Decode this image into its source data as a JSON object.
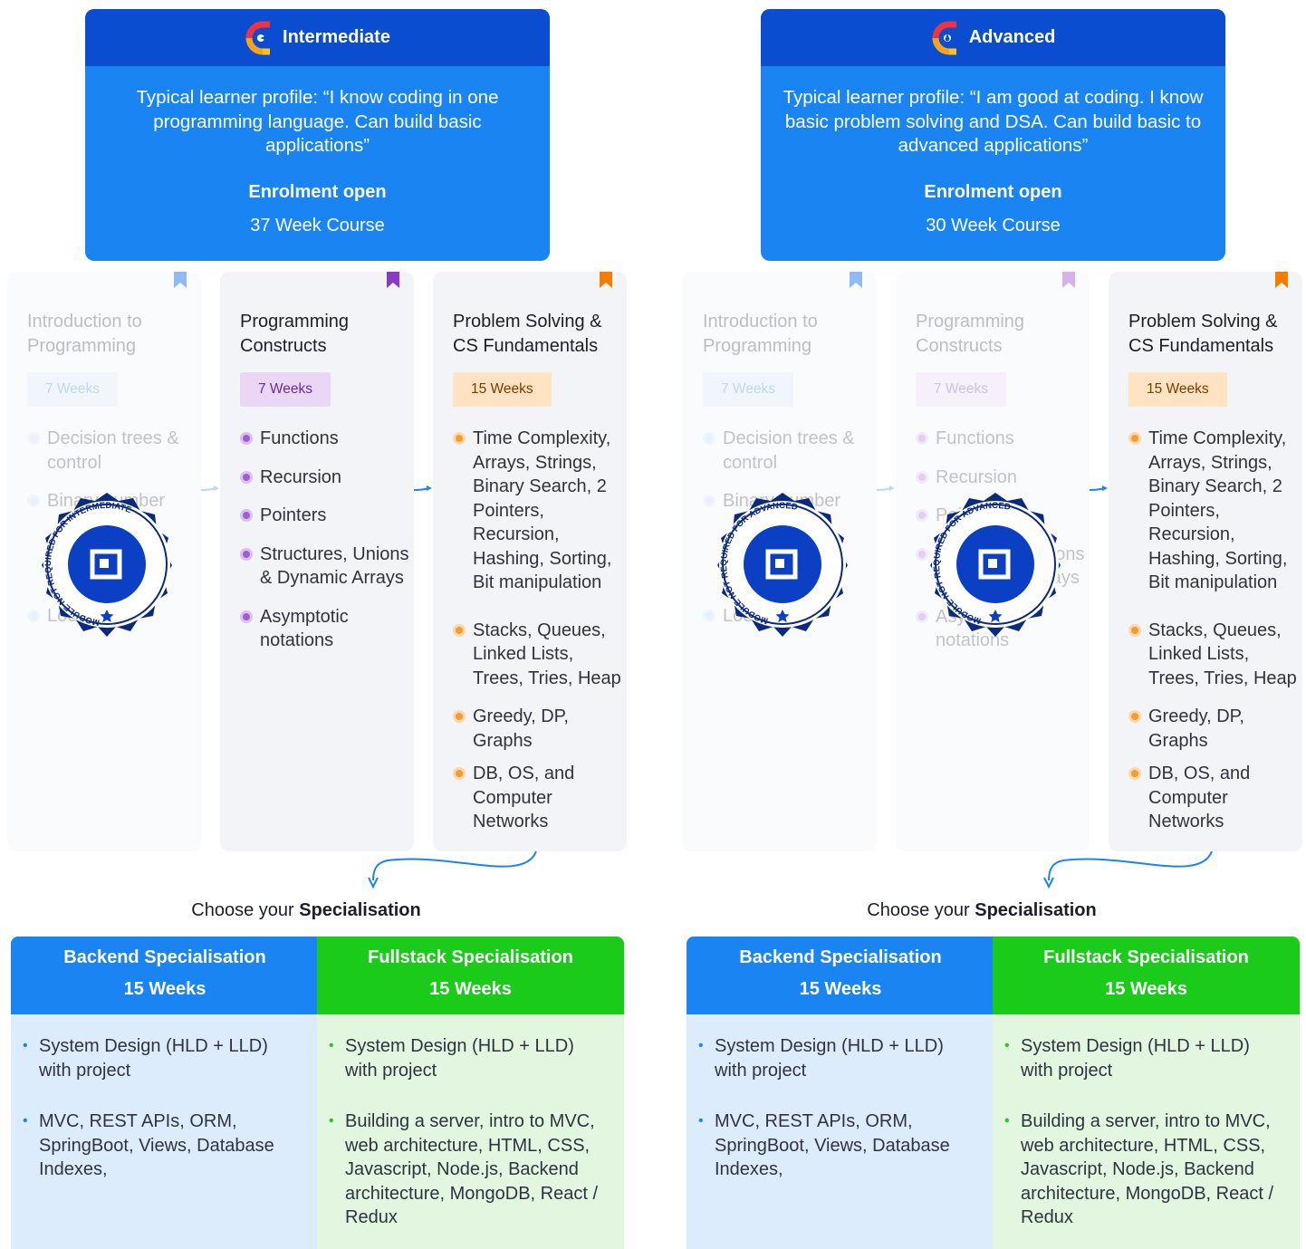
{
  "tracks": [
    {
      "title": "Intermediate",
      "profile": "Typical learner profile: “I know coding in one programming language. Can build basic applications”",
      "enrolment": "Enrolment open",
      "duration": "37 Week Course",
      "badge_text": "MODULE NOT REQUIRED FOR INTERMEDIATE"
    },
    {
      "title": "Advanced",
      "profile": "Typical learner profile: “I am good at coding. I know basic problem solving and DSA. Can build basic to advanced applications”",
      "enrolment": "Enrolment open",
      "duration": "30 Week Course",
      "badge_text": "MODULE NOT REQUIRED FOR ADVANCED"
    }
  ],
  "modules": {
    "intro": {
      "title": "Introduction to Programming",
      "weeks": "7 Weeks",
      "topics": [
        "Decision trees & control",
        "Binary number",
        "Loops"
      ]
    },
    "constructs": {
      "title": "Programming Constructs",
      "weeks": "7 Weeks",
      "topics": [
        "Functions",
        "Recursion",
        "Pointers",
        "Structures, Unions & Dynamic Arrays",
        "Asymptotic notations"
      ]
    },
    "problem_solving": {
      "title": "Problem Solving & CS Fundamentals",
      "weeks": "15 Weeks",
      "topics": [
        "Time Complexity, Arrays, Strings, Binary Search, 2 Pointers, Recursion, Hashing, Sorting, Bit manipulation",
        "Stacks, Queues, Linked Lists, Trees, Tries, Heap",
        "Greedy, DP, Graphs",
        "DB, OS, and Computer Networks"
      ]
    }
  },
  "choose": {
    "prefix": "Choose your",
    "bold": "Specialisation"
  },
  "specialisations": {
    "backend": {
      "title": "Backend Specialisation",
      "weeks": "15 Weeks",
      "items": [
        "System Design (HLD + LLD) with project",
        "MVC, REST APIs, ORM, SpringBoot, Views, Database Indexes,"
      ]
    },
    "fullstack": {
      "title": "Fullstack Specialisation",
      "weeks": "15 Weeks",
      "items": [
        "System Design (HLD + LLD) with project",
        "Building a server, intro to MVC, web architecture, HTML, CSS, Javascript, Node.js, Backend architecture, MongoDB, React / Redux"
      ]
    }
  },
  "colors": {
    "header_dark": "#0a4dd0",
    "header": "#1a85f2",
    "backend": "#1a85f2",
    "fullstack": "#1acb1a",
    "badge": "#0b2a7c",
    "intro_accent": "#8fbaf4",
    "constructs_accent": "#8a3bc4",
    "ps_accent": "#f57c00"
  },
  "icons": [
    "logo-icon",
    "bookmark-icon",
    "arrow-right-icon",
    "curved-arrow-icon",
    "badge-icon",
    "bullet-icon"
  ]
}
